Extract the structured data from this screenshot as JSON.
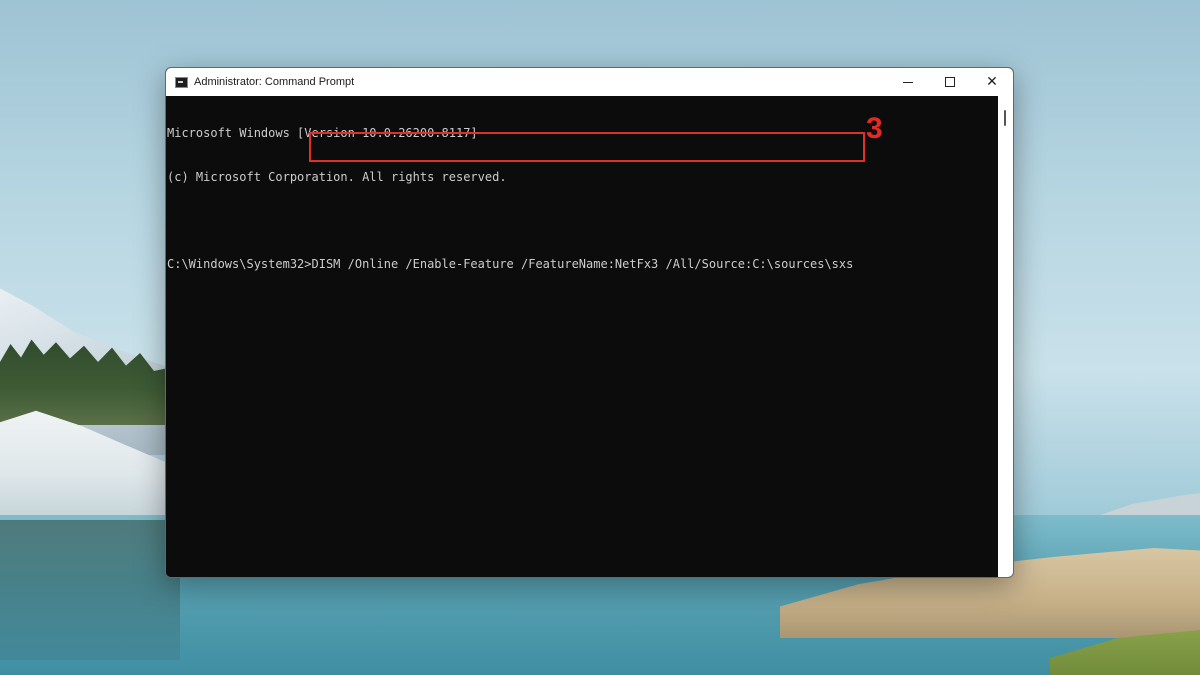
{
  "window": {
    "title": "Administrator: Command Prompt",
    "controls": {
      "minimize": "",
      "maximize": "",
      "close": "✕"
    }
  },
  "console": {
    "lines": [
      "Microsoft Windows [Version 10.0.26200.8117]",
      "(c) Microsoft Corporation. All rights reserved.",
      "",
      "C:\\Windows\\System32>DISM /Online /Enable-Feature /FeatureName:NetFx3 /All/Source:C:\\sources\\sxs"
    ]
  },
  "annotation": {
    "step_number": "3",
    "color": "#e32b25"
  },
  "icons": {
    "app": "cmd-icon"
  }
}
